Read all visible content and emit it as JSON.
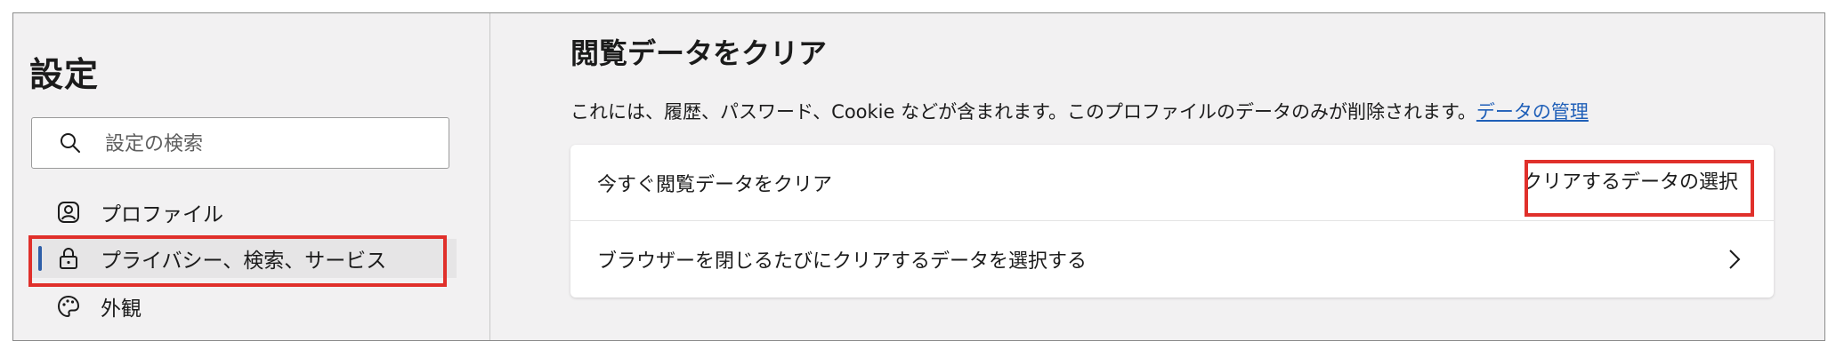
{
  "sidebar": {
    "title": "設定",
    "search": {
      "placeholder": "設定の検索",
      "value": ""
    },
    "items": [
      {
        "label": "プロファイル",
        "icon": "profile-icon"
      },
      {
        "label": "プライバシー、検索、サービス",
        "icon": "lock-icon",
        "selected": true
      },
      {
        "label": "外観",
        "icon": "palette-icon"
      }
    ]
  },
  "main": {
    "title": "閲覧データをクリア",
    "description": "これには、履歴、パスワード、Cookie などが含まれます。このプロファイルのデータのみが削除されます。",
    "manage_link": "データの管理",
    "rows": [
      {
        "label": "今すぐ閲覧データをクリア",
        "action_label": "クリアするデータの選択"
      },
      {
        "label": "ブラウザーを閉じるたびにクリアするデータを選択する",
        "icon": "chevron-right-icon"
      }
    ]
  },
  "colors": {
    "accent": "#2f5fa8",
    "link": "#1f5fb8",
    "highlight": "#e0302b"
  }
}
